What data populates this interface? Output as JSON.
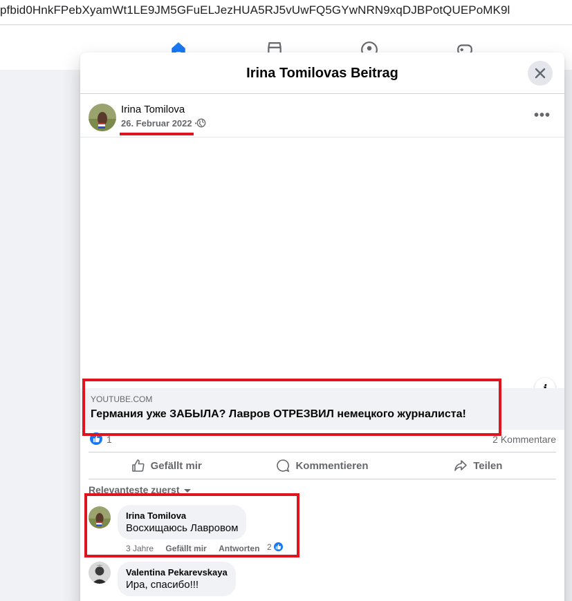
{
  "browser": {
    "url": "pfbid0HnkFPebXyamWt1LE9JM5GFuELJezHUA5RJ5vUwFQ5GYwNRN9xqDJBPotQUEPoMK9l"
  },
  "topnav": {
    "icons": [
      "home-icon",
      "marketplace-icon",
      "groups-icon",
      "gaming-icon"
    ]
  },
  "modal": {
    "title": "Irina Tomilovas Beitrag",
    "close_icon": "close-icon"
  },
  "post": {
    "author": "Irina Tomilova",
    "date": "26. Februar 2022",
    "date_separator": "·",
    "audience_icon": "globe-icon",
    "more_label": "•••",
    "link_domain": "YOUTUBE.COM",
    "link_title": "Германия уже ЗАБЫЛА? Лавров ОТРЕЗВИЛ немецкого журналиста!",
    "info_label": "i",
    "likes": "1",
    "comments_count": "2 Kommentare"
  },
  "actions": {
    "like": "Gefällt mir",
    "comment": "Kommentieren",
    "share": "Teilen"
  },
  "sort_label": "Relevanteste zuerst",
  "comments": [
    {
      "author": "Irina Tomilova",
      "text": "Восхищаюсь Лавровом",
      "time": "3 Jahre",
      "like_label": "Gefällt mir",
      "reply_label": "Antworten",
      "reactions": "2"
    },
    {
      "author": "Valentina Pekarevskaya",
      "text": "Ира, спасибо!!!"
    }
  ],
  "colors": {
    "facebook_blue": "#1877f2",
    "annotation_red": "#e0141e",
    "secondary_text": "#65676b"
  }
}
